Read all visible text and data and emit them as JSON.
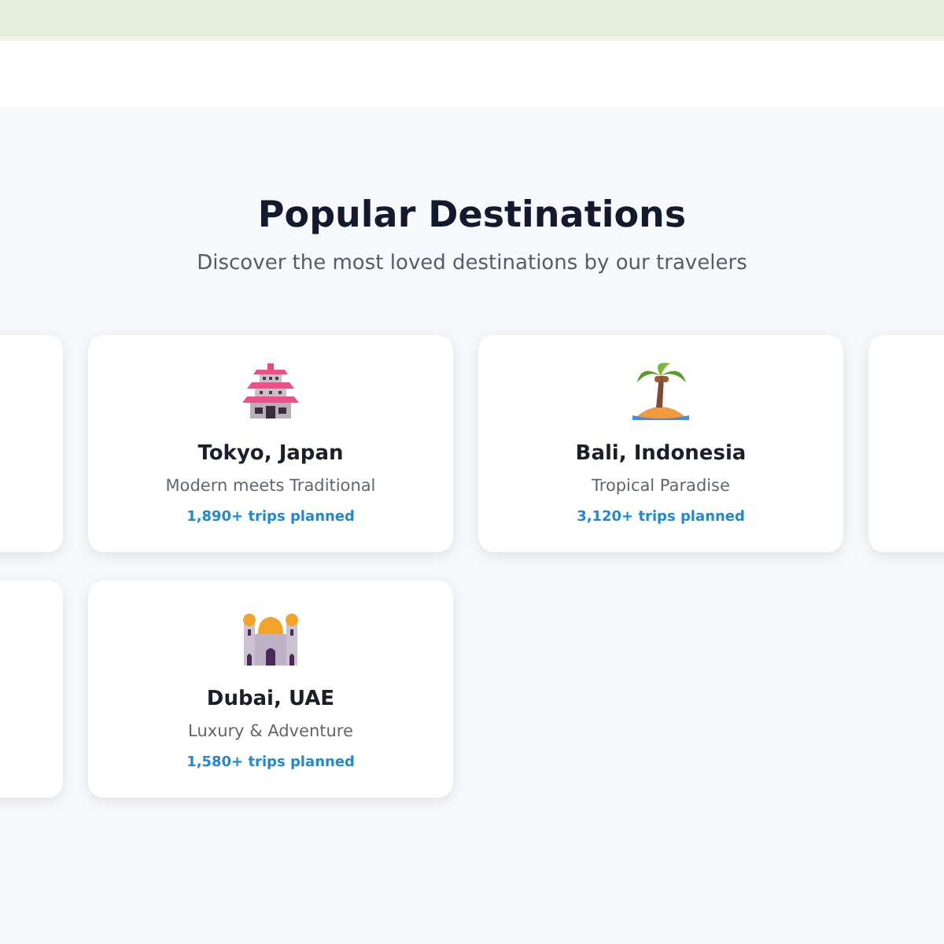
{
  "section": {
    "title": "Popular Destinations",
    "subtitle": "Discover the most loved destinations by our travelers"
  },
  "rows": [
    [
      {
        "kind": "partial"
      },
      {
        "kind": "pagoda",
        "name": "Tokyo, Japan",
        "tagline": "Modern meets Traditional",
        "trips": "1,890+ trips planned"
      },
      {
        "kind": "palm",
        "name": "Bali, Indonesia",
        "tagline": "Tropical Paradise",
        "trips": "3,120+ trips planned"
      },
      {
        "kind": "partial"
      }
    ],
    [
      {
        "kind": "partial"
      },
      {
        "kind": "mosque",
        "name": "Dubai, UAE",
        "tagline": "Luxury & Adventure",
        "trips": "1,580+ trips planned"
      }
    ]
  ]
}
